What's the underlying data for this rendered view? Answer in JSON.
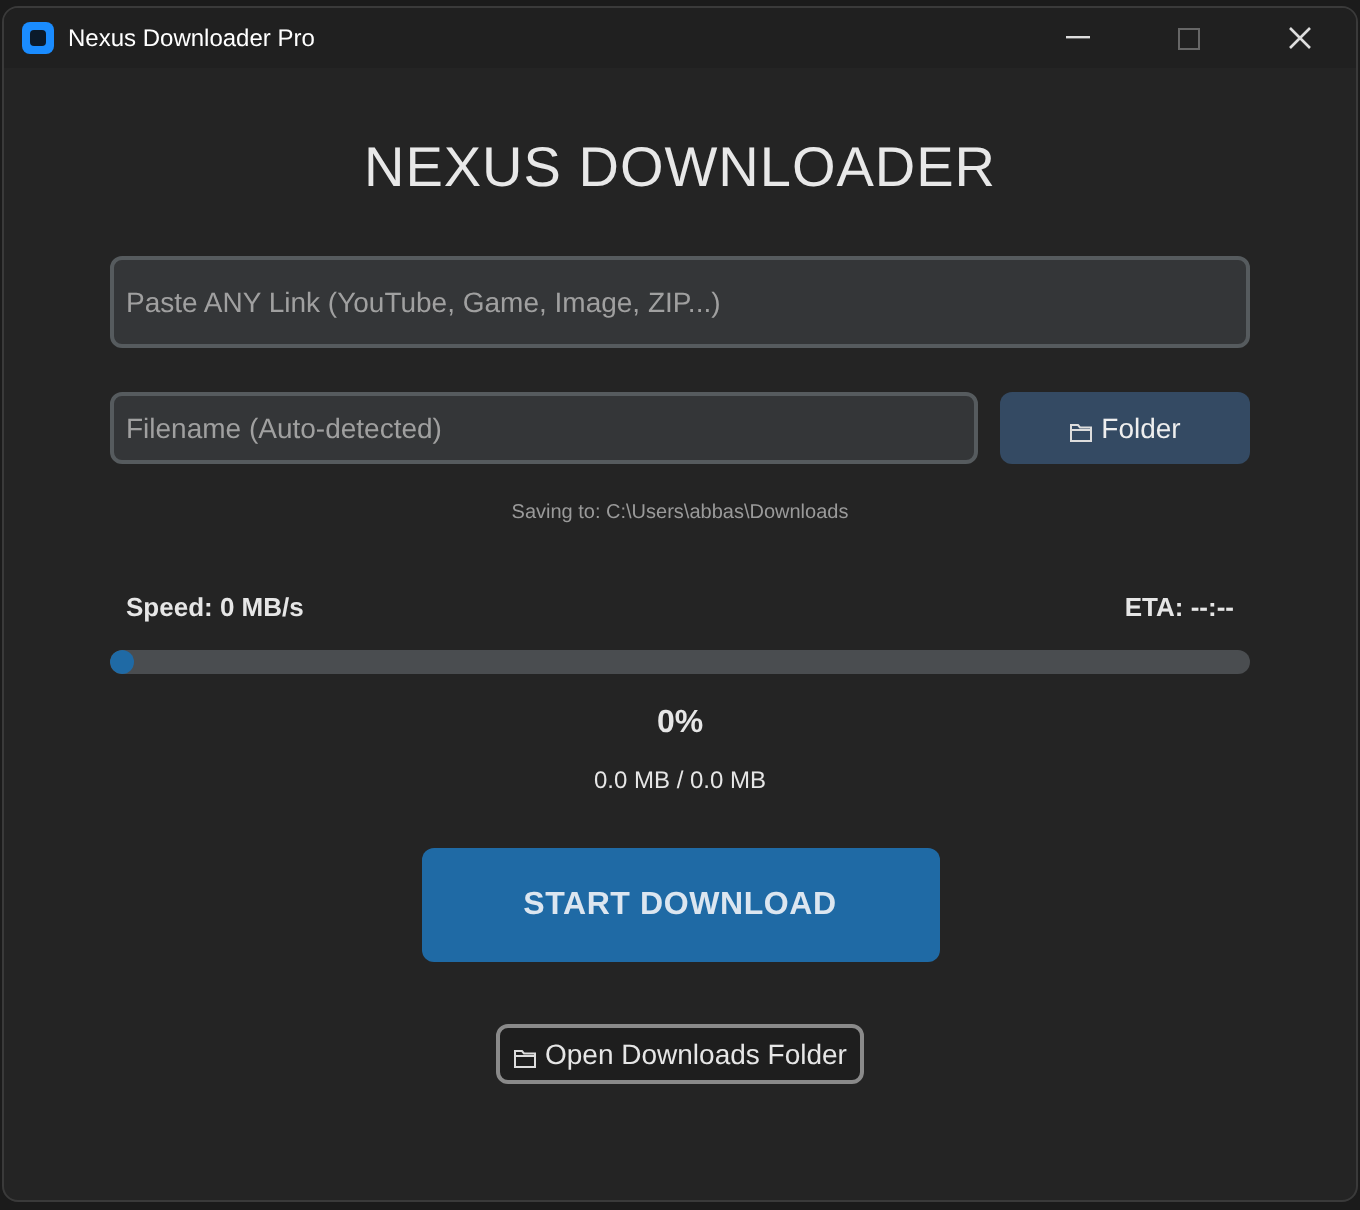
{
  "window": {
    "title": "Nexus Downloader Pro"
  },
  "heading": "NEXUS DOWNLOADER",
  "link_field": {
    "placeholder": "Paste ANY Link (YouTube, Game, Image, ZIP...)"
  },
  "filename_field": {
    "placeholder": "Filename (Auto-detected)"
  },
  "folder_button": "Folder",
  "save_path": "Saving to: C:\\Users\\abbas\\Downloads",
  "speed": "Speed: 0 MB/s",
  "eta": "ETA: --:--",
  "progress": {
    "level": 0.0
  },
  "percent": "0%",
  "size": "0.0 MB / 0.0 MB",
  "start_button": "START DOWNLOAD",
  "open_folder_button": "Open Downloads Folder"
}
